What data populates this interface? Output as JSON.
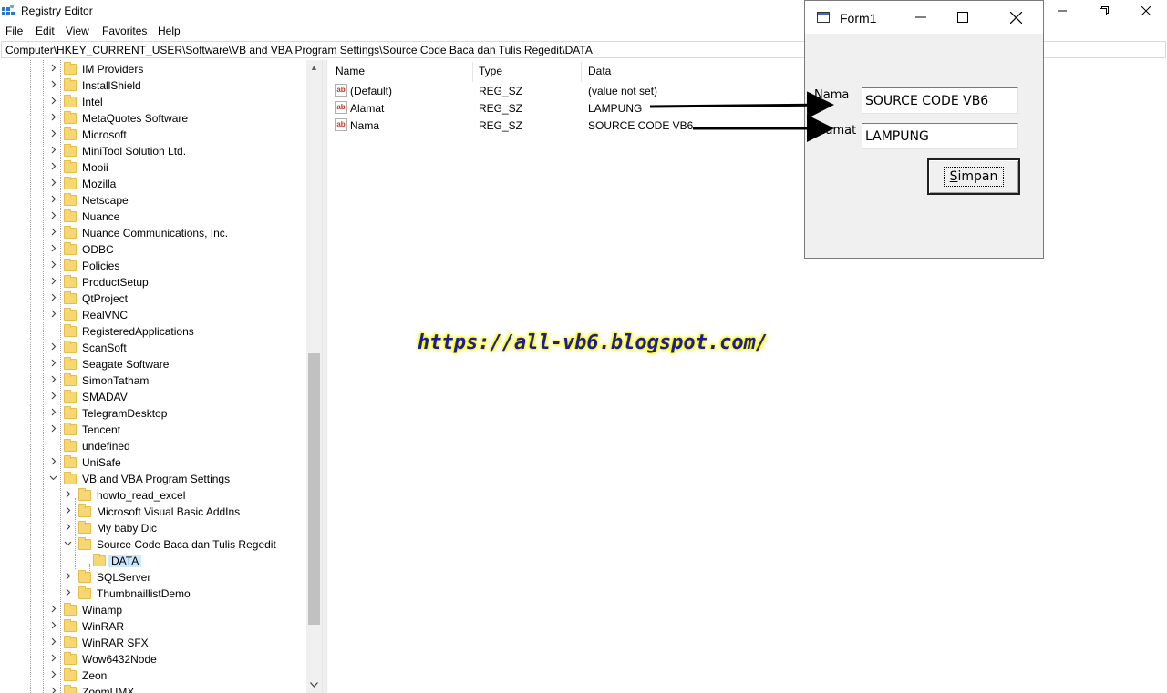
{
  "window": {
    "title": "Registry Editor"
  },
  "menu": [
    {
      "label": "File",
      "u": "F",
      "rest": "ile"
    },
    {
      "label": "Edit",
      "u": "E",
      "rest": "dit"
    },
    {
      "label": "View",
      "u": "V",
      "rest": "iew"
    },
    {
      "label": "Favorites",
      "u": "F",
      "rest": "avorites"
    },
    {
      "label": "Help",
      "u": "H",
      "rest": "elp"
    }
  ],
  "address": "Computer\\HKEY_CURRENT_USER\\Software\\VB and VBA Program Settings\\Source Code Baca dan Tulis Regedit\\DATA",
  "tree": {
    "top_items": [
      "IM Providers",
      "InstallShield",
      "Intel",
      "MetaQuotes Software",
      "Microsoft",
      "MiniTool Solution Ltd.",
      "Mooii",
      "Mozilla",
      "Netscape",
      "Nuance",
      "Nuance Communications, Inc.",
      "ODBC",
      "Policies",
      "ProductSetup",
      "QtProject",
      "RealVNC",
      "RegisteredApplications",
      "ScanSoft",
      "Seagate Software",
      "SimonTatham",
      "SMADAV",
      "TelegramDesktop",
      "Tencent",
      "undefined",
      "UniSafe"
    ],
    "expanded_parent": "VB and VBA Program Settings",
    "children": [
      "howto_read_excel",
      "Microsoft Visual Basic AddIns",
      "My baby Dic",
      "Source Code Baca dan Tulis Regedit"
    ],
    "selected": "DATA",
    "children_after": [
      "SQLServer",
      "ThumbnaillistDemo"
    ],
    "bottom_items": [
      "Winamp",
      "WinRAR",
      "WinRAR SFX",
      "Wow6432Node",
      "Zeon",
      "ZoomUMX"
    ]
  },
  "list": {
    "columns": [
      "Name",
      "Type",
      "Data"
    ],
    "rows": [
      {
        "name": "(Default)",
        "type": "REG_SZ",
        "data": "(value not set)"
      },
      {
        "name": "Alamat",
        "type": "REG_SZ",
        "data": "LAMPUNG"
      },
      {
        "name": "Nama",
        "type": "REG_SZ",
        "data": "SOURCE CODE VB6"
      }
    ]
  },
  "form1": {
    "title": "Form1",
    "label_nama": "Nama",
    "label_alamat": "Alamat",
    "value_nama": "SOURCE CODE VB6",
    "value_alamat": "LAMPUNG",
    "save_u": "S",
    "save_rest": "impan"
  },
  "watermark": "https://all-vb6.blogspot.com/"
}
